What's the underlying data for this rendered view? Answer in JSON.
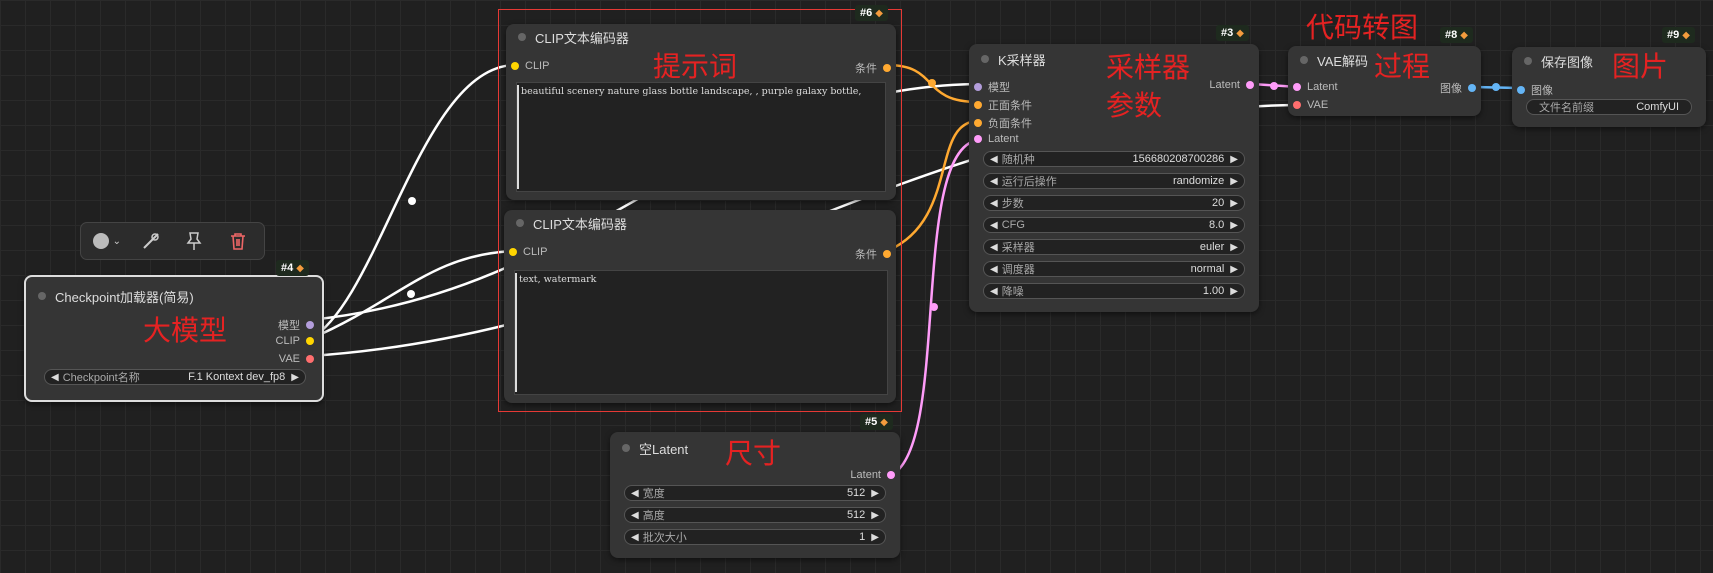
{
  "toolbar": {
    "color_icon": "color-circle-icon",
    "bypass_icon": "bypass-icon",
    "pin_icon": "pin-icon",
    "delete_icon": "trash-icon"
  },
  "nodes": {
    "checkpoint": {
      "id": "#4",
      "title": "Checkpoint加载器(简易)",
      "outputs": [
        "模型",
        "CLIP",
        "VAE"
      ],
      "widget": {
        "label": "Checkpoint名称",
        "value": "F.1 Kontext dev_fp8"
      }
    },
    "clip_pos": {
      "id": "#6",
      "title": "CLIP文本编码器",
      "input": "CLIP",
      "output": "条件",
      "text": "beautiful scenery nature glass bottle landscape, , purple galaxy bottle,"
    },
    "clip_neg": {
      "title": "CLIP文本编码器",
      "input": "CLIP",
      "output": "条件",
      "text": "text, watermark"
    },
    "empty_latent": {
      "id": "#5",
      "title": "空Latent",
      "output": "Latent",
      "widgets": [
        {
          "label": "宽度",
          "value": "512"
        },
        {
          "label": "高度",
          "value": "512"
        },
        {
          "label": "批次大小",
          "value": "1"
        }
      ]
    },
    "ksampler": {
      "id": "#3",
      "title": "K采样器",
      "inputs": [
        "模型",
        "正面条件",
        "负面条件",
        "Latent"
      ],
      "output": "Latent",
      "widgets": [
        {
          "label": "随机种",
          "value": "156680208700286"
        },
        {
          "label": "运行后操作",
          "value": "randomize"
        },
        {
          "label": "步数",
          "value": "20"
        },
        {
          "label": "CFG",
          "value": "8.0"
        },
        {
          "label": "采样器",
          "value": "euler"
        },
        {
          "label": "调度器",
          "value": "normal"
        },
        {
          "label": "降噪",
          "value": "1.00"
        }
      ]
    },
    "vae_decode": {
      "id": "#8",
      "title": "VAE解码",
      "inputs": [
        "Latent",
        "VAE"
      ],
      "output": "图像"
    },
    "save_image": {
      "id": "#9",
      "title": "保存图像",
      "input": "图像",
      "widget": {
        "label": "文件名前缀",
        "value": "ComfyUI"
      }
    }
  },
  "annotations": {
    "model": "大模型",
    "prompt": "提示词",
    "size": "尺寸",
    "sampler_line1": "采样器",
    "sampler_line2": "参数",
    "decode_line1": "代码转图",
    "decode_line2": "过程",
    "image": "图片"
  },
  "colors": {
    "model": "#b39ddb",
    "clip": "#ffd500",
    "vae": "#ff6e6e",
    "conditioning": "#ffa931",
    "latent": "#ff9cf9",
    "image": "#64b5f6",
    "annotation": "#e52222",
    "selection": "#e53935"
  }
}
